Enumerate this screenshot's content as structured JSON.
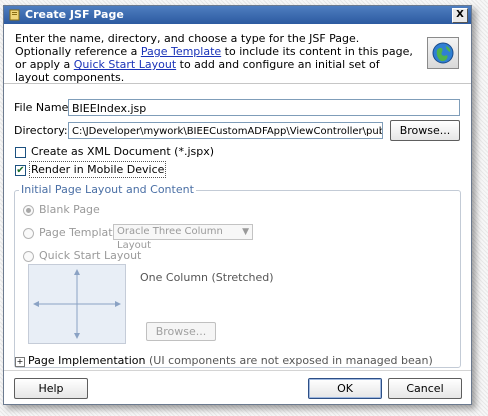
{
  "window": {
    "title": "Create JSF Page",
    "close_label": "X"
  },
  "header": {
    "desc_part1": "Enter the name, directory, and choose a type for the JSF Page. Optionally reference a ",
    "link_page_template": "Page Template",
    "desc_part2": " to include its content in this page, or apply a ",
    "link_quick_start": "Quick Start Layout",
    "desc_part3": " to add and configure an initial set of layout components."
  },
  "form": {
    "file_name_label": "File Name:",
    "file_name_value": "BIEEIndex.jsp",
    "directory_label": "Directory:",
    "directory_value": "C:\\JDeveloper\\mywork\\BIEECustomADFApp\\ViewController\\public_html",
    "browse_label": "Browse...",
    "create_xml_label": "Create as XML Document (*.jspx)",
    "create_xml_checked": false,
    "render_mobile_label": "Render in Mobile Device",
    "render_mobile_checked": true
  },
  "layout_group": {
    "title": "Initial Page Layout and Content",
    "blank_page_label": "Blank Page",
    "page_template_label": "Page Template",
    "page_template_option": "Oracle Three Column Layout",
    "quick_start_label": "Quick Start Layout",
    "layout_name": "One Column (Stretched)",
    "browse_label": "Browse..."
  },
  "page_impl": {
    "label": "Page Implementation",
    "note": " (UI components are not exposed in managed bean)"
  },
  "footer": {
    "help_label": "Help",
    "ok_label": "OK",
    "cancel_label": "Cancel"
  },
  "colors": {
    "title_bar": "#2c5aa0",
    "link": "#1a33b8",
    "group_title": "#4a6fa5"
  },
  "icons": [
    "jsf-page-icon",
    "close-icon",
    "globe-icon",
    "check-icon",
    "move-arrows-icon",
    "chevron-down-icon",
    "expand-icon"
  ]
}
